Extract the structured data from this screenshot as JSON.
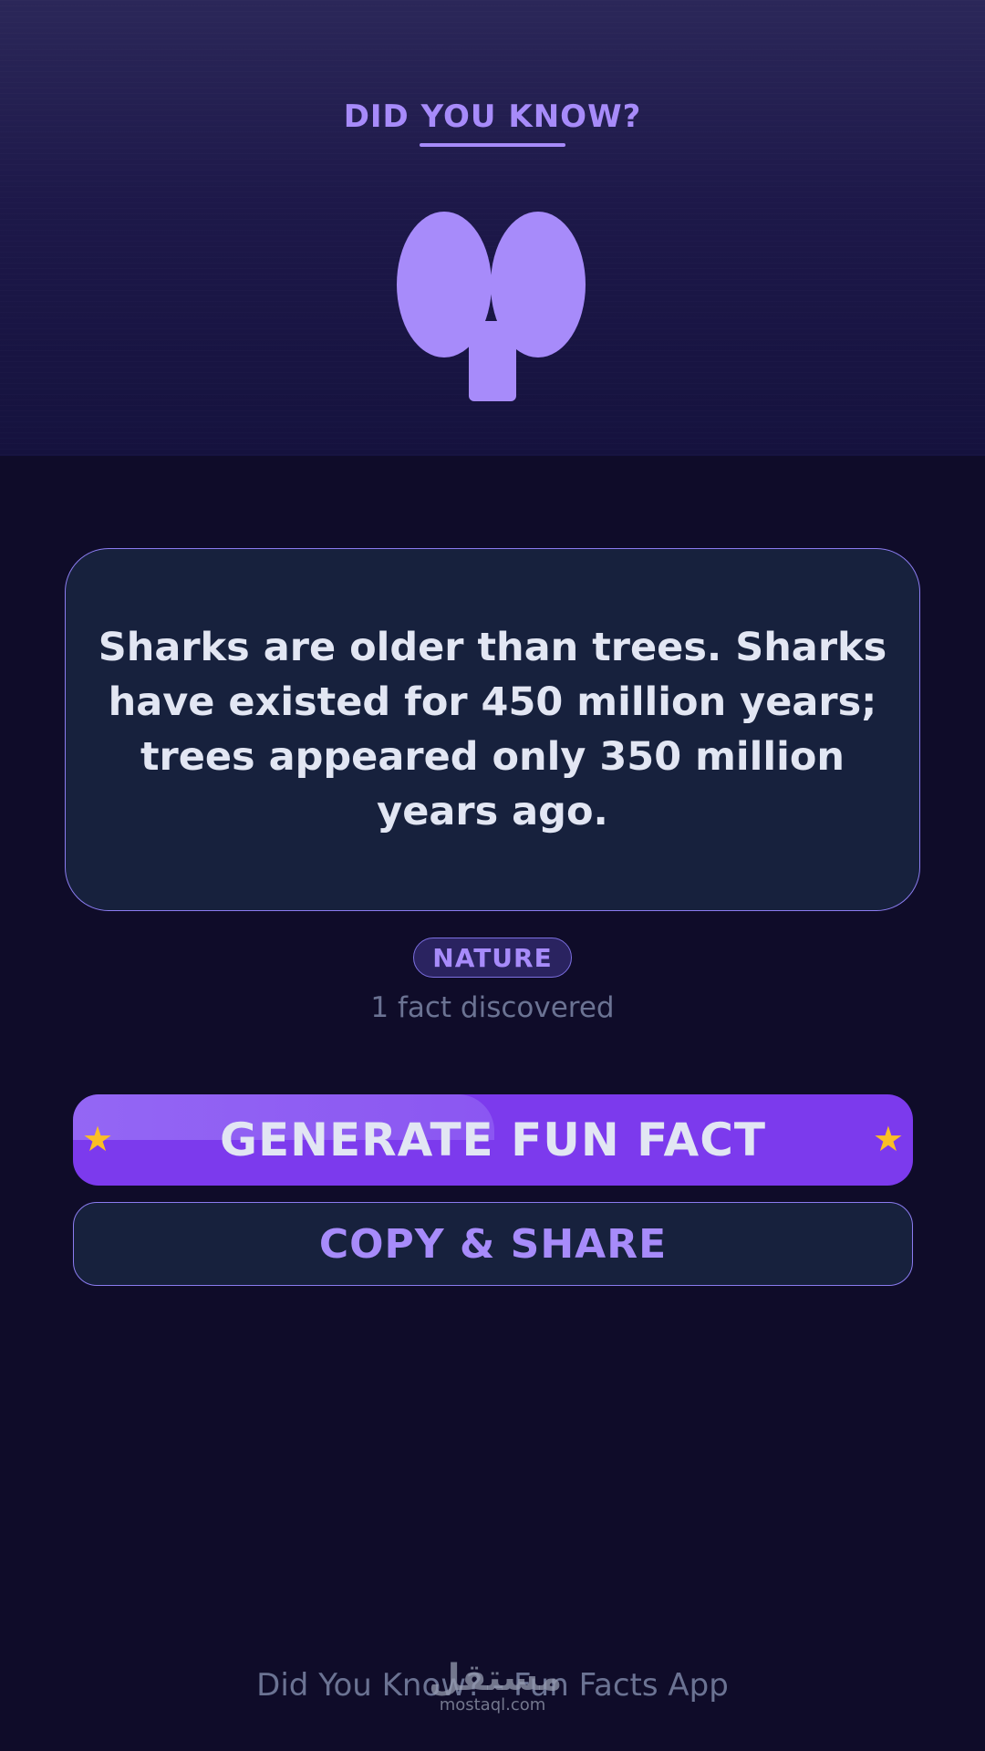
{
  "header": {
    "title": "DID YOU KNOW?",
    "icon": "brain-icon",
    "accent_color": "#a78bfa"
  },
  "fact": {
    "text": "Sharks are older than trees. Sharks have existed for 450 million years; trees appeared only 350 million years ago.",
    "category": "NATURE",
    "counter": "1 fact discovered"
  },
  "buttons": {
    "generate_label": "GENERATE FUN FACT",
    "generate_color": "#7c3aed",
    "star_glyph": "★",
    "star_color": "#fbbf24",
    "copy_label": "COPY & SHARE"
  },
  "footer": {
    "text": "Did You Know? - Fun Facts App"
  },
  "watermark": {
    "logo": "مستقل",
    "url": "mostaql.com"
  }
}
